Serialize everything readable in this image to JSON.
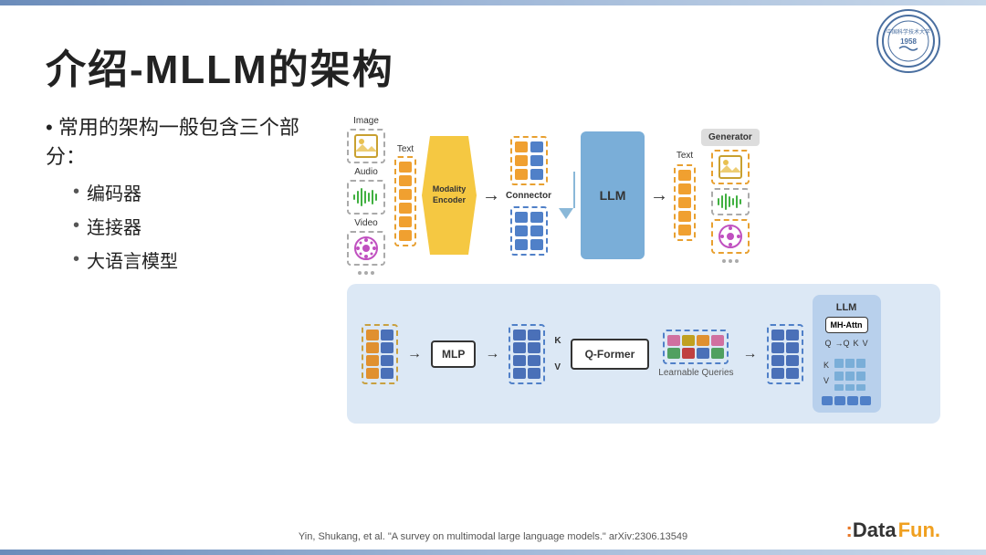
{
  "slide": {
    "title": "介绍-MLLM的架构",
    "top_bar_color": "#7aaed8",
    "bottom_bar_color": "#7aaed8"
  },
  "bullets": {
    "main": "• 常用的架构一般包含三个部分：",
    "sub": [
      "编码器",
      "连接器",
      "大语言模型"
    ]
  },
  "diagram": {
    "modalities": [
      "Image",
      "Audio",
      "Video"
    ],
    "modality_encoder_label": "Modality\nEncoder",
    "connector_label": "Connector",
    "llm_label": "LLM",
    "generator_label": "Generator",
    "text_output_label": "Text",
    "bottom": {
      "mlp_label": "MLP",
      "qformer_label": "Q-Former",
      "llm_label": "LLM",
      "mhattn_label": "MH-Attn",
      "learnable_label": "Learnable Queries",
      "kv_labels": [
        "K",
        "V"
      ],
      "qkv_labels": [
        "Q",
        "→Q",
        "K",
        "V"
      ]
    }
  },
  "citation": "Yin, Shukang, et al. \"A survey on multimodal large language models.\" arXiv:2306.13549",
  "brand": {
    "prefix": "Data",
    "suffix": "Fun."
  },
  "university": {
    "year": "1958"
  },
  "icons": {
    "image": "🖼",
    "audio": "🎵",
    "video": "🎬",
    "document": "📄",
    "output_image": "🖼",
    "output_audio": "🔊",
    "output_video": "🎬"
  }
}
